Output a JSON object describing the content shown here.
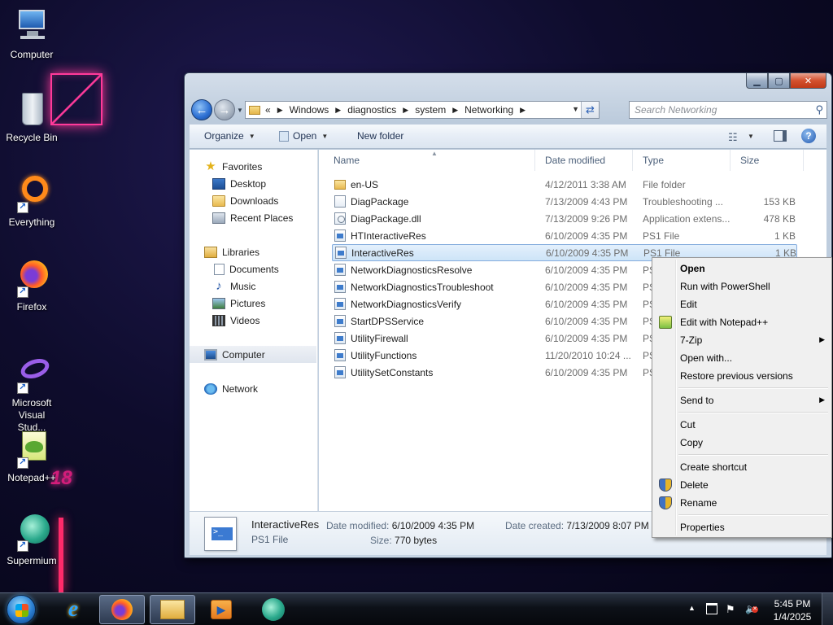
{
  "desktop": {
    "icons": [
      {
        "label": "Computer"
      },
      {
        "label": "Recycle Bin"
      },
      {
        "label": "Everything"
      },
      {
        "label": "Firefox"
      },
      {
        "label": "Microsoft Visual Stud..."
      },
      {
        "label": "Notepad++"
      },
      {
        "label": "Supermium"
      }
    ],
    "wallpaper_text": "18"
  },
  "window": {
    "breadcrumb": [
      "Windows",
      "diagnostics",
      "system",
      "Networking"
    ],
    "breadcrumb_prefix": "«",
    "search_placeholder": "Search Networking",
    "toolbar": {
      "organize": "Organize",
      "open": "Open",
      "new_folder": "New folder"
    },
    "nav_pane": {
      "favorites": "Favorites",
      "desktop": "Desktop",
      "downloads": "Downloads",
      "recent": "Recent Places",
      "libraries": "Libraries",
      "documents": "Documents",
      "music": "Music",
      "pictures": "Pictures",
      "videos": "Videos",
      "computer": "Computer",
      "network": "Network"
    },
    "columns": {
      "name": "Name",
      "date": "Date modified",
      "type": "Type",
      "size": "Size"
    },
    "files": [
      {
        "name": "en-US",
        "date": "4/12/2011 3:38 AM",
        "type": "File folder",
        "size": ""
      },
      {
        "name": "DiagPackage",
        "date": "7/13/2009 4:43 PM",
        "type": "Troubleshooting ...",
        "size": "153 KB"
      },
      {
        "name": "DiagPackage.dll",
        "date": "7/13/2009 9:26 PM",
        "type": "Application extens...",
        "size": "478 KB"
      },
      {
        "name": "HTInteractiveRes",
        "date": "6/10/2009 4:35 PM",
        "type": "PS1 File",
        "size": "1 KB"
      },
      {
        "name": "InteractiveRes",
        "date": "6/10/2009 4:35 PM",
        "type": "PS1 File",
        "size": "1 KB"
      },
      {
        "name": "NetworkDiagnosticsResolve",
        "date": "6/10/2009 4:35 PM",
        "type": "PS",
        "size": ""
      },
      {
        "name": "NetworkDiagnosticsTroubleshoot",
        "date": "6/10/2009 4:35 PM",
        "type": "PS",
        "size": ""
      },
      {
        "name": "NetworkDiagnosticsVerify",
        "date": "6/10/2009 4:35 PM",
        "type": "PS",
        "size": ""
      },
      {
        "name": "StartDPSService",
        "date": "6/10/2009 4:35 PM",
        "type": "PS",
        "size": ""
      },
      {
        "name": "UtilityFirewall",
        "date": "6/10/2009 4:35 PM",
        "type": "PS",
        "size": ""
      },
      {
        "name": "UtilityFunctions",
        "date": "11/20/2010 10:24 ...",
        "type": "PS",
        "size": ""
      },
      {
        "name": "UtilitySetConstants",
        "date": "6/10/2009 4:35 PM",
        "type": "PS",
        "size": ""
      }
    ],
    "details": {
      "name": "InteractiveRes",
      "type": "PS1 File",
      "modified_label": "Date modified:",
      "modified": "6/10/2009 4:35 PM",
      "created_label": "Date created:",
      "created": "7/13/2009 8:07 PM",
      "size_label": "Size:",
      "size": "770 bytes"
    }
  },
  "context_menu": {
    "open": "Open",
    "run_ps": "Run with PowerShell",
    "edit": "Edit",
    "edit_npp": "Edit with Notepad++",
    "zip": "7-Zip",
    "open_with": "Open with...",
    "restore": "Restore previous versions",
    "send_to": "Send to",
    "cut": "Cut",
    "copy": "Copy",
    "shortcut": "Create shortcut",
    "delete": "Delete",
    "rename": "Rename",
    "properties": "Properties"
  },
  "taskbar": {
    "time": "5:45 PM",
    "date": "1/4/2025"
  },
  "colors": {
    "accent": "#ff3a9a",
    "selection": "#cde4f8",
    "taskbar": "#0d1118"
  }
}
